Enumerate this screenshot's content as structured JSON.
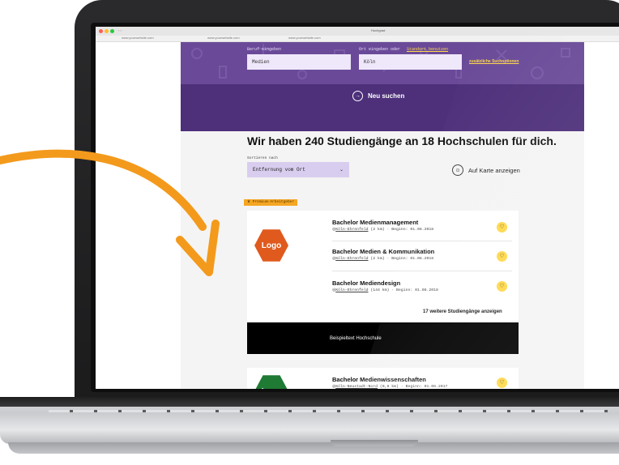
{
  "browser": {
    "tabs": [
      "www.yourwebsite.com",
      "www.yourwebsite.com",
      "www.yourwebsite.com"
    ],
    "title": "Hochgrad",
    "dots": [
      "#ff5f56",
      "#ffbd2e",
      "#27c93f"
    ]
  },
  "search": {
    "job_label": "Beruf eingeben",
    "job_value": "Medien",
    "place_label_prefix": "Ort eingeben oder",
    "place_label_link": "Standort benutzen",
    "place_value": "Köln",
    "extra_options": "zusätzliche Suchoptionen",
    "new_search": "Neu suchen"
  },
  "results": {
    "headline": "Wir haben 240 Studiengänge an 18 Hochschulen für dich.",
    "sort_label": "Sortieren nach",
    "sort_value": "Entfernung vom Ort",
    "map_link": "Auf Karte anzeigen"
  },
  "cards": [
    {
      "badge": "Premium-Arbeitgeber",
      "logo_text": "Logo",
      "logo_color": "#e05a1e",
      "courses": [
        {
          "title": "Bachelor Medienmanagement",
          "location": "Köln-Ehrenfeld",
          "meta": "(2 km) · Beginn: 01.08.2018"
        },
        {
          "title": "Bachelor Medien & Kommunikation",
          "location": "Köln-Ehrenfeld",
          "meta": "(2 km) · Beginn: 01.08.2018"
        },
        {
          "title": "Bachelor Mediendesign",
          "location": "Köln-Ehrenfeld",
          "meta": "(144 km) · Beginn: 01.08.2018"
        }
      ],
      "more_link": "17 weitere Studiengänge anzeigen",
      "banner": "Beispieltext Hochschule"
    },
    {
      "logo_text": "Logo",
      "logo_color": "#1f7a34",
      "courses": [
        {
          "title": "Bachelor Medienwissenschaften",
          "location": "Köln-Neustadt-Nord",
          "meta": "(0,8 km) · Beginn: 01.08.2017"
        }
      ]
    }
  ],
  "colors": {
    "hero": "#6a4a98",
    "accent_yellow": "#ffd84a",
    "arrow": "#f39a1c"
  }
}
